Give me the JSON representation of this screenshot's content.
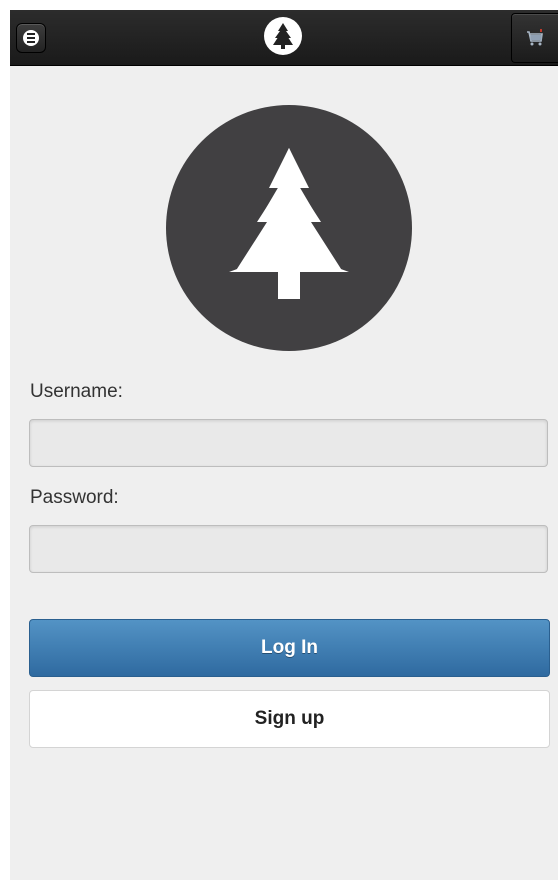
{
  "header": {
    "menu_icon": "menu-icon",
    "brand_icon": "tree-logo-icon",
    "cart_icon": "cart-icon"
  },
  "logo": {
    "icon": "pine-tree-icon",
    "color": "#414042"
  },
  "form": {
    "username_label": "Username:",
    "username_value": "",
    "password_label": "Password:",
    "password_value": "",
    "login_label": "Log In",
    "signup_label": "Sign up"
  },
  "colors": {
    "topbar": "#1f1f1f",
    "background": "#efefef",
    "primary_button": "#3d7cb5"
  }
}
